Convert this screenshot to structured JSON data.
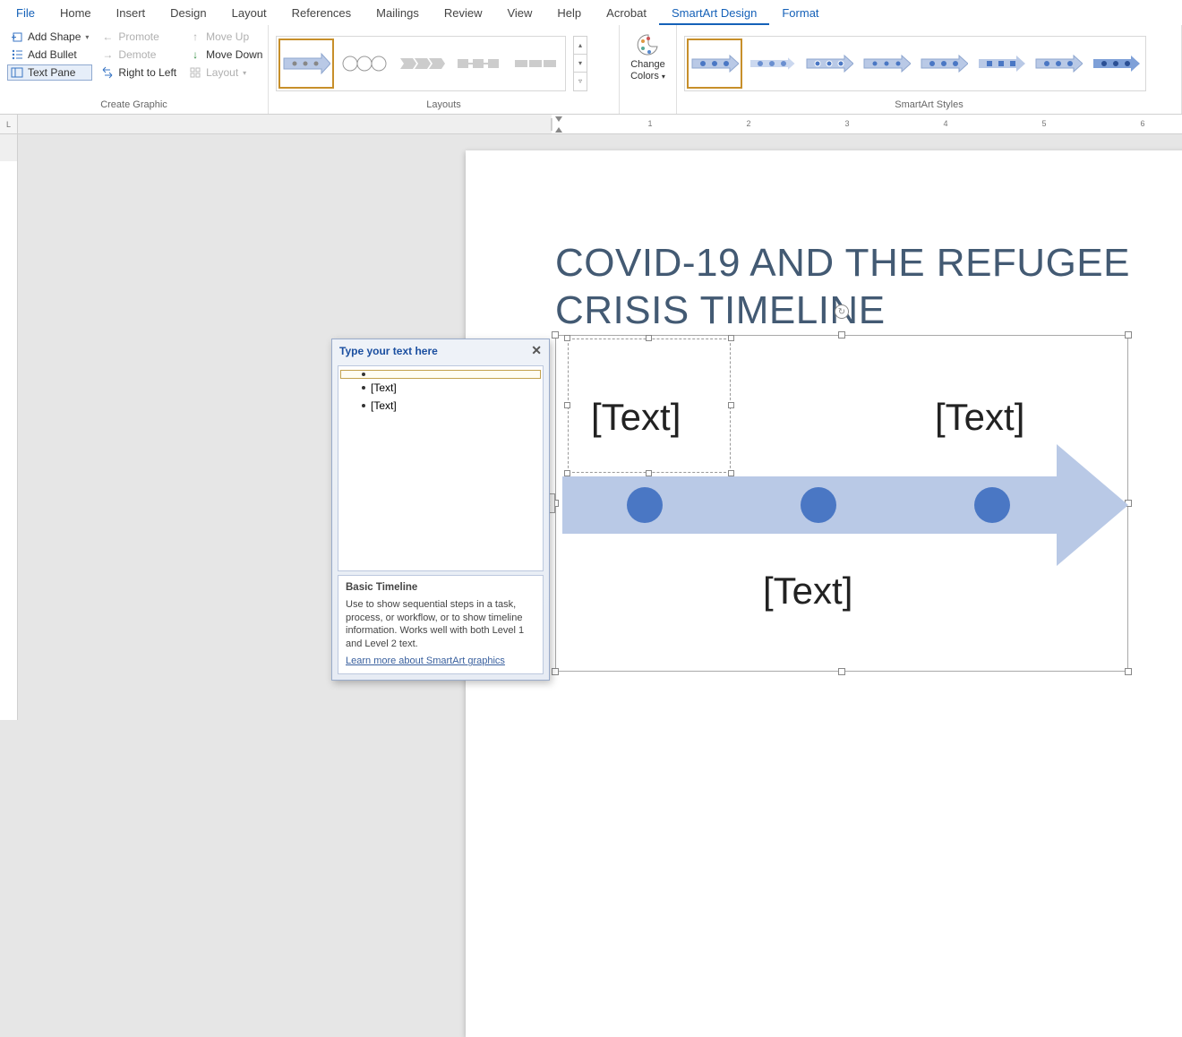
{
  "tabs": {
    "file": "File",
    "home": "Home",
    "insert": "Insert",
    "design": "Design",
    "layout": "Layout",
    "references": "References",
    "mailings": "Mailings",
    "review": "Review",
    "view": "View",
    "help": "Help",
    "acrobat": "Acrobat",
    "smartart": "SmartArt Design",
    "format": "Format"
  },
  "ribbon": {
    "create_graphic": {
      "label": "Create Graphic",
      "add_shape": "Add Shape",
      "add_bullet": "Add Bullet",
      "text_pane": "Text Pane",
      "promote": "Promote",
      "demote": "Demote",
      "right_to_left": "Right to Left",
      "move_up": "Move Up",
      "move_down": "Move Down",
      "layout_btn": "Layout"
    },
    "layouts_label": "Layouts",
    "change_colors": "Change Colors",
    "styles_label": "SmartArt Styles"
  },
  "document": {
    "title": "COVID-19 AND THE REFUGEE CRISIS TIMELINE",
    "placeholders": {
      "p1": "[Text]",
      "p2": "[Text]",
      "p3": "[Text]"
    }
  },
  "textpane": {
    "header": "Type your text here",
    "item1": "",
    "item2": "[Text]",
    "item3": "[Text]",
    "footer_title": "Basic Timeline",
    "footer_body": "Use to show sequential steps in a task, process, or workflow, or to show timeline information. Works well with both Level 1 and Level 2 text.",
    "footer_link": "Learn more about SmartArt graphics"
  },
  "scroll": {
    "up": "▴",
    "down": "▾",
    "more": "▿"
  }
}
